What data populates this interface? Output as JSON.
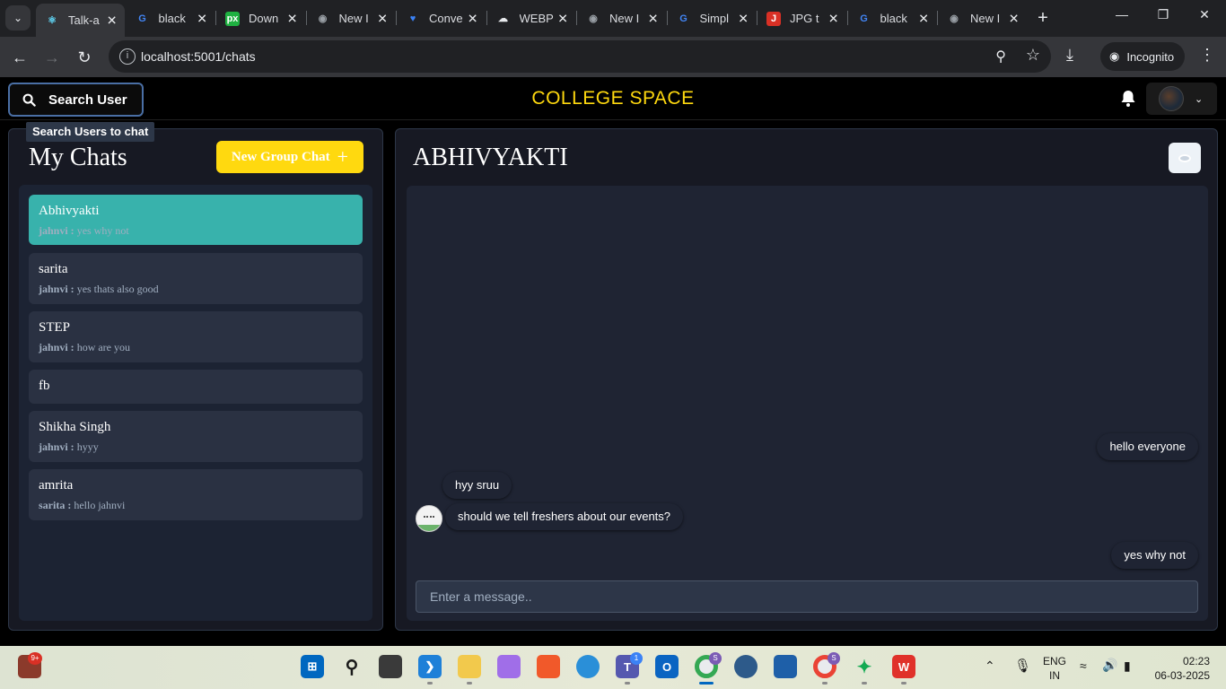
{
  "browser": {
    "tabs": [
      {
        "title": "Talk-a",
        "favicon": "react-icon",
        "color": "#61dafb",
        "active": true
      },
      {
        "title": "black",
        "favicon": "google-icon",
        "color": "#4285f4"
      },
      {
        "title": "Down",
        "favicon": "px",
        "color": "#1fb141"
      },
      {
        "title": "New I",
        "favicon": "incognito-icon",
        "color": "#9aa0a6"
      },
      {
        "title": "Conve",
        "favicon": "heart-icon",
        "color": "#3b82f6"
      },
      {
        "title": "WEBP",
        "favicon": "cloud-icon",
        "color": "#e8eaed"
      },
      {
        "title": "New I",
        "favicon": "incognito-icon",
        "color": "#9aa0a6"
      },
      {
        "title": "Simpl",
        "favicon": "google-icon",
        "color": "#4285f4"
      },
      {
        "title": "JPG t",
        "favicon": "jpg-png-icon",
        "color": "#d93025"
      },
      {
        "title": "black",
        "favicon": "google-icon",
        "color": "#4285f4"
      },
      {
        "title": "New I",
        "favicon": "incognito-icon",
        "color": "#9aa0a6"
      }
    ],
    "url": "localhost:5001/chats",
    "incognito_label": "Incognito"
  },
  "app": {
    "search_button": "Search User",
    "search_tooltip": "Search Users to chat",
    "brand": "COLLEGE SPACE",
    "colors": {
      "brand": "#ffd90f",
      "active_chat": "#38b2ac",
      "new_group_button": "#ffd90f"
    }
  },
  "sidebar": {
    "title": "My Chats",
    "new_group_button": "New Group Chat",
    "chats": [
      {
        "name": "Abhivyakti",
        "sender": "jahnvi :",
        "latest": "yes why not",
        "active": true
      },
      {
        "name": "sarita",
        "sender": "jahnvi :",
        "latest": "yes thats also good"
      },
      {
        "name": "STEP",
        "sender": "jahnvi :",
        "latest": "how are you"
      },
      {
        "name": "fb",
        "sender": "",
        "latest": ""
      },
      {
        "name": "Shikha Singh",
        "sender": "jahnvi :",
        "latest": "hyyy"
      },
      {
        "name": "amrita",
        "sender": "sarita :",
        "latest": "hello jahnvi"
      }
    ]
  },
  "chat": {
    "title": "ABHIVYAKTI",
    "messages": [
      {
        "text": "hello everyone",
        "side": "right"
      },
      {
        "text": "hyy sruu",
        "side": "left"
      },
      {
        "text": "should we tell freshers about our events?",
        "side": "left"
      },
      {
        "text": "yes why not",
        "side": "right"
      }
    ],
    "input_placeholder": "Enter a message.."
  },
  "taskbar": {
    "notification_count": "9+",
    "teams_badge": "1",
    "chrome_badge": "S",
    "language": "ENG",
    "region": "IN",
    "time": "02:23",
    "date": "06-03-2025"
  }
}
